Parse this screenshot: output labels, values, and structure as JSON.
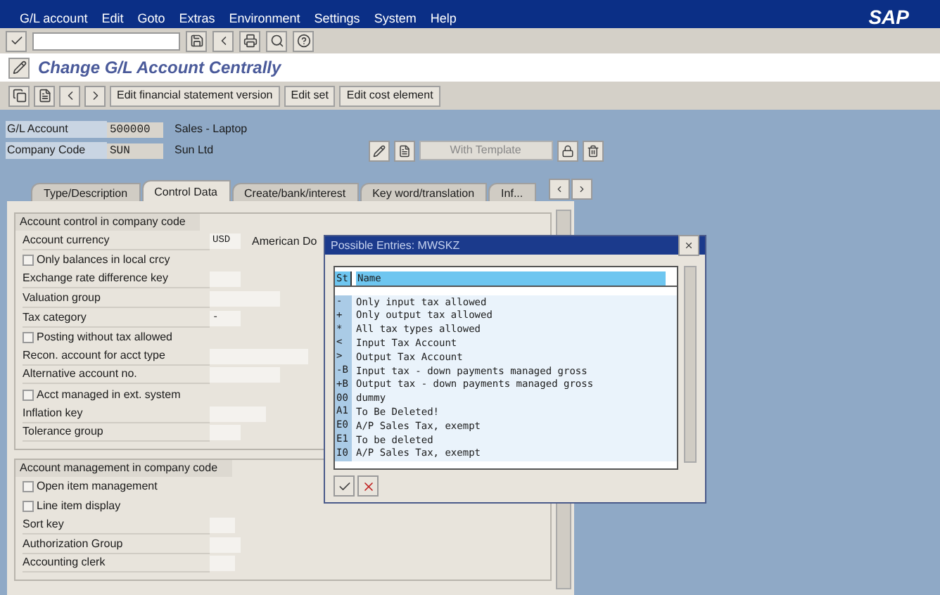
{
  "menu_bar": {
    "items": [
      "G/L account",
      "Edit",
      "Goto",
      "Extras",
      "Environment",
      "Settings",
      "System",
      "Help"
    ],
    "logo": "SAP"
  },
  "title": "Change G/L Account Centrally",
  "app_toolbar": {
    "buttons": [
      "Edit financial statement version",
      "Edit set",
      "Edit cost element"
    ]
  },
  "header": {
    "fields": [
      {
        "label": "G/L Account",
        "value": "500000",
        "description": "Sales - Laptop"
      },
      {
        "label": "Company Code",
        "value": "SUN",
        "description": "Sun Ltd"
      }
    ],
    "template_button": "With Template"
  },
  "tabs": [
    {
      "label": "Type/Description",
      "selected": false
    },
    {
      "label": "Control Data",
      "selected": true
    },
    {
      "label": "Create/bank/interest",
      "selected": false
    },
    {
      "label": "Key word/translation",
      "selected": false
    },
    {
      "label": "Inf...",
      "selected": false
    }
  ],
  "groups": [
    {
      "title": "Account control in company code",
      "rows": [
        {
          "kind": "field",
          "label": "Account currency",
          "value": "USD",
          "description": "American Do"
        },
        {
          "kind": "checkbox",
          "label": "Only balances in local crcy",
          "checked": false
        },
        {
          "kind": "field",
          "label": "Exchange rate difference key"
        },
        {
          "kind": "field",
          "label": "Valuation group"
        },
        {
          "kind": "field",
          "label": "Tax category",
          "value": "-"
        },
        {
          "kind": "checkbox",
          "label": "Posting without tax allowed",
          "checked": false
        },
        {
          "kind": "field",
          "label": "Recon. account for acct type"
        },
        {
          "kind": "field",
          "label": "Alternative account no."
        },
        {
          "kind": "checkbox",
          "label": "Acct managed in ext. system",
          "checked": false
        },
        {
          "kind": "field",
          "label": "Inflation key"
        },
        {
          "kind": "field",
          "label": "Tolerance group"
        }
      ]
    },
    {
      "title": "Account management in company code",
      "rows": [
        {
          "kind": "checkbox",
          "label": "Open item management",
          "checked": false
        },
        {
          "kind": "checkbox",
          "label": "Line item display",
          "checked": false
        },
        {
          "kind": "field",
          "label": "Sort key"
        },
        {
          "kind": "field",
          "label": "Authorization Group"
        },
        {
          "kind": "field",
          "label": "Accounting clerk"
        }
      ]
    }
  ],
  "popup": {
    "title": "Possible Entries: MWSKZ",
    "columns": [
      "St",
      "Name"
    ],
    "rows": [
      {
        "code": "-",
        "name": "Only input tax allowed"
      },
      {
        "code": "+",
        "name": "Only output tax allowed"
      },
      {
        "code": "*",
        "name": "All tax types allowed"
      },
      {
        "code": "<",
        "name": "Input Tax Account"
      },
      {
        "code": ">",
        "name": "Output Tax Account"
      },
      {
        "code": "-B",
        "name": "Input tax - down payments managed gross"
      },
      {
        "code": "+B",
        "name": "Output tax - down payments managed gross"
      },
      {
        "code": "00",
        "name": "dummy"
      },
      {
        "code": "A1",
        "name": "To Be Deleted!"
      },
      {
        "code": "E0",
        "name": "A/P Sales Tax, exempt"
      },
      {
        "code": "E1",
        "name": "To be deleted"
      },
      {
        "code": "I0",
        "name": "A/P Sales Tax, exempt"
      }
    ]
  }
}
